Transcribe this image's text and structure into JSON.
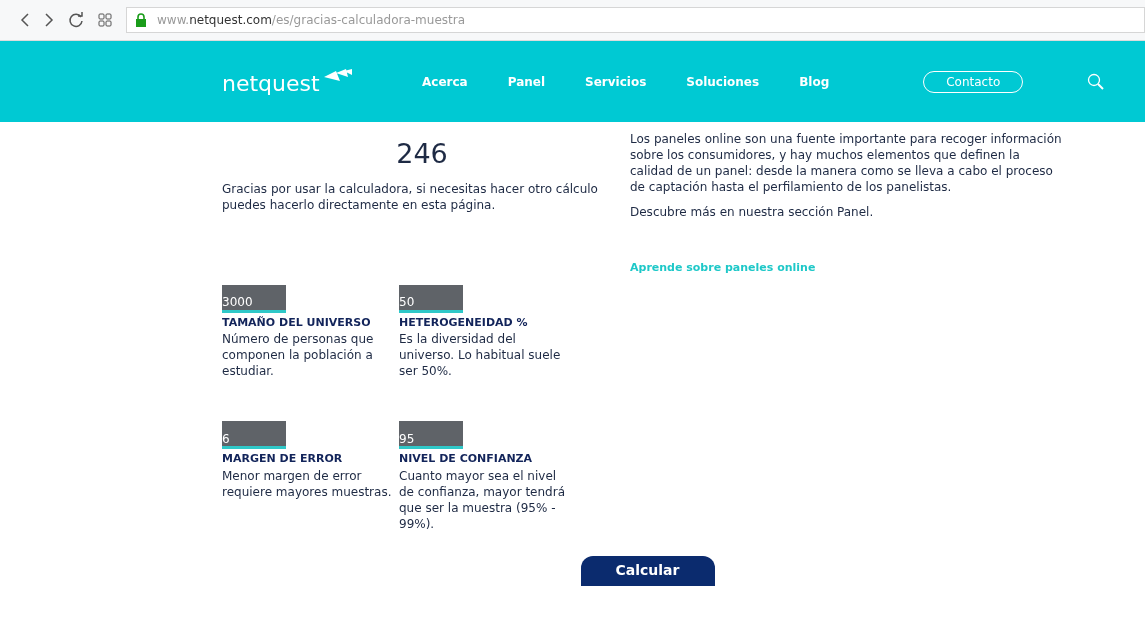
{
  "browser": {
    "url_prefix": "www.",
    "url_domain": "netquest.com",
    "url_path": "/es/gracias-calculadora-muestra"
  },
  "header": {
    "logo": "netquest",
    "nav": [
      "Acerca",
      "Panel",
      "Servicios",
      "Soluciones",
      "Blog"
    ],
    "contact": "Contacto"
  },
  "result": {
    "value": "246",
    "text": "Gracias por usar la calculadora, si necesitas hacer otro cálculo puedes hacerlo directamente en esta página."
  },
  "fields": [
    {
      "value": "3000",
      "label": "TAMAÑO DEL UNIVERSO",
      "help": "Número de personas que componen la población a estudiar."
    },
    {
      "value": "50",
      "label": "HETEROGENEIDAD %",
      "help": "Es la diversidad del universo. Lo habitual suele ser 50%."
    },
    {
      "value": "6",
      "label": "MARGEN DE ERROR",
      "help": "Menor margen de error requiere mayores muestras."
    },
    {
      "value": "95",
      "label": "NIVEL DE CONFIANZA",
      "help": "Cuanto mayor sea el nivel de confianza, mayor tendrá que ser la muestra (95% - 99%)."
    }
  ],
  "info": {
    "paragraphs": [
      "Los paneles online son una fuente importante para recoger información sobre los consumidores, y hay muchos elementos que definen la calidad de un panel: desde la manera como se lleva a cabo el proceso de captación hasta el perfilamiento de los panelistas.",
      "Descubre más en nuestra sección Panel."
    ],
    "link": "Aprende sobre paneles online"
  },
  "submit": "Calcular"
}
